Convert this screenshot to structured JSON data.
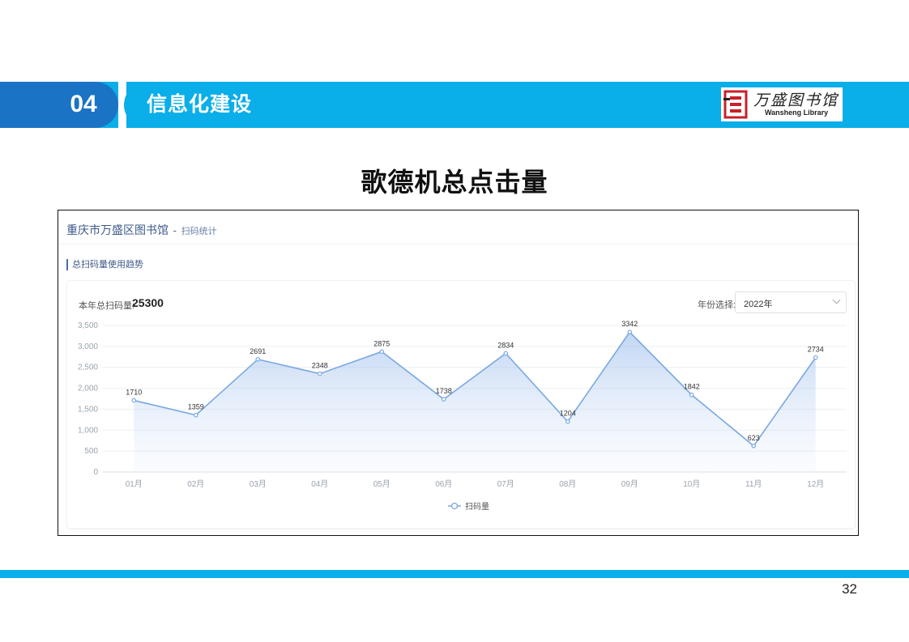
{
  "header": {
    "section_number": "04",
    "section_title": "信息化建设",
    "logo_text_cn": "万盛图书馆",
    "logo_text_en": "Wansheng Library",
    "accent_color": "#0aaee9",
    "number_pill_color": "#1a73c5"
  },
  "page_heading": "歌德机总点击量",
  "screenshot": {
    "breadcrumb_main": "重庆市万盛区图书馆",
    "breadcrumb_separator": "-",
    "breadcrumb_sub": "扫码统计",
    "trend_title": "总扫码量使用趋势",
    "total_label": "本年总扫码量:",
    "total_value": "25300",
    "year_label": "年份选择:",
    "year_selected": "2022年"
  },
  "chart_data": {
    "type": "area",
    "categories": [
      "01月",
      "02月",
      "03月",
      "04月",
      "05月",
      "06月",
      "07月",
      "08月",
      "09月",
      "10月",
      "11月",
      "12月"
    ],
    "series": [
      {
        "name": "扫码量",
        "values": [
          1710,
          1359,
          2691,
          2348,
          2875,
          1738,
          2834,
          1204,
          3342,
          1842,
          623,
          2734
        ],
        "color": "#7aa8e0"
      }
    ],
    "y_ticks": [
      "0",
      "500",
      "1,000",
      "1,500",
      "2,000",
      "2,500",
      "3,000",
      "3,500"
    ],
    "ylim": [
      0,
      3500
    ],
    "grid": true,
    "legend_position": "bottom-center"
  },
  "footer": {
    "page_number": "32"
  }
}
